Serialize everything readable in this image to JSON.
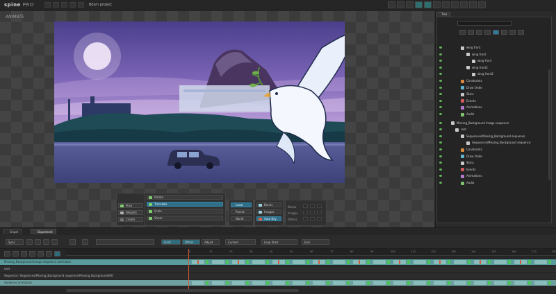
{
  "app": {
    "logo_main": "spine",
    "logo_pro": "PRO",
    "project_name": "Bdsm project"
  },
  "viewport": {
    "mode_label": "ANIMATE"
  },
  "tools": {
    "pose": "Pose",
    "weights": "Weights",
    "create": "Create",
    "rotate": "Rotate",
    "translate": "Translate",
    "scale": "Scale",
    "shear": "Shear",
    "local": "Local",
    "parent": "Parent",
    "world": "World",
    "bones": "Bones",
    "images": "Images",
    "auto_key": "Auto Key",
    "bones_lbl": "Bones",
    "images_lbl": "Images",
    "others_lbl": "Others"
  },
  "tree": {
    "tab": "Tree",
    "rows": [
      {
        "text": "wing front",
        "indent": 22,
        "color": "#c9c9c9"
      },
      {
        "text": "wing front",
        "indent": 30,
        "color": "#c9c9c9"
      },
      {
        "text": "wing front",
        "indent": 38,
        "color": "#c9c9c9"
      },
      {
        "text": "wing front2",
        "indent": 30,
        "color": "#c9c9c9"
      },
      {
        "text": "wing front2",
        "indent": 38,
        "color": "#c9c9c9"
      },
      {
        "text": "Constraints",
        "indent": 22,
        "color": "#d88a3e"
      },
      {
        "text": "Draw Order",
        "indent": 22,
        "color": "#5fb4cf"
      },
      {
        "text": "Skins",
        "indent": 22,
        "color": "#c9c9c9"
      },
      {
        "text": "Events",
        "indent": 22,
        "color": "#d15a5a"
      },
      {
        "text": "Animations",
        "indent": 22,
        "color": "#b57ad0"
      },
      {
        "text": "Audio",
        "indent": 22,
        "color": "#7fc36f"
      },
      {
        "text": "Missing_Background image sequence",
        "indent": 8,
        "color": "#c9c9c9"
      },
      {
        "text": "root",
        "indent": 14,
        "color": "#c9c9c9"
      },
      {
        "text": "Sequences/Missing_Background sequence",
        "indent": 22,
        "color": "#c9c9c9"
      },
      {
        "text": "Sequences/Missing_Background sequence",
        "indent": 30,
        "color": "#c9c9c9"
      },
      {
        "text": "Constraints",
        "indent": 22,
        "color": "#d88a3e"
      },
      {
        "text": "Draw Order",
        "indent": 22,
        "color": "#5fb4cf"
      },
      {
        "text": "Skins",
        "indent": 22,
        "color": "#c9c9c9"
      },
      {
        "text": "Events",
        "indent": 22,
        "color": "#d15a5a"
      },
      {
        "text": "Animations",
        "indent": 22,
        "color": "#b57ad0"
      },
      {
        "text": "Audio",
        "indent": 22,
        "color": "#7fc36f"
      }
    ]
  },
  "dock": {
    "tab_graph": "Graph",
    "tab_dopesheet": "Dopesheet"
  },
  "timeline": {
    "sync": "Sync",
    "limit": "Limit",
    "offset": "Offset",
    "adjust": "Adjust",
    "current": "Current",
    "loop_start": "Loop Start",
    "end": "End",
    "ruler_ticks": [
      "0",
      "10",
      "20",
      "30",
      "40",
      "50",
      "60",
      "70",
      "80",
      "90",
      "100",
      "110",
      "120",
      "130",
      "140",
      "150",
      "160",
      "170",
      "180"
    ],
    "tracks": [
      {
        "name": "Missing_Background image sequence  animation",
        "style": "t1"
      },
      {
        "name": "root",
        "style": "t2"
      },
      {
        "name": "Sequence: Sequences/Missing_Background sequence/Missing_Background000",
        "style": "t2"
      },
      {
        "name": "Audience  animation",
        "style": "t3"
      }
    ]
  }
}
